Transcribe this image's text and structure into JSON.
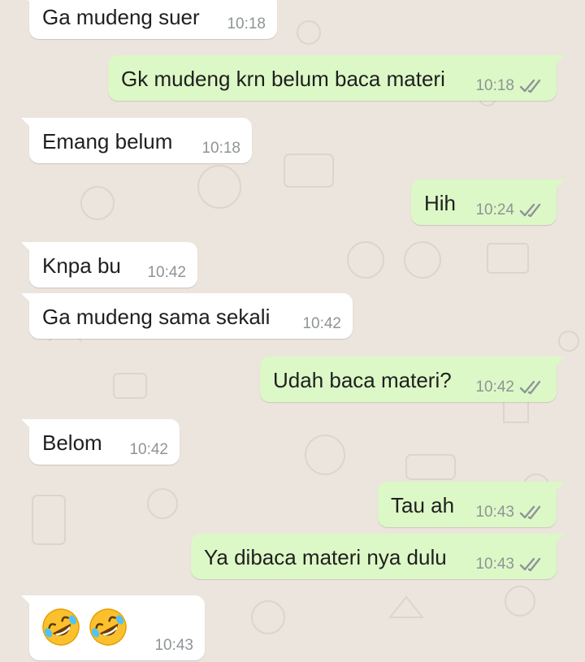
{
  "messages": [
    {
      "direction": "in",
      "text": "Ga mudeng suer",
      "time": "10:18"
    },
    {
      "direction": "out",
      "text": "Gk mudeng krn belum baca materi",
      "time": "10:18",
      "status": "double-check-icon"
    },
    {
      "direction": "in",
      "text": "Emang belum",
      "time": "10:18"
    },
    {
      "direction": "out",
      "text": "Hih",
      "time": "10:24",
      "status": "double-check-icon"
    },
    {
      "direction": "in",
      "text": "Knpa bu",
      "time": "10:42"
    },
    {
      "direction": "in",
      "text": "Ga mudeng sama sekali",
      "time": "10:42"
    },
    {
      "direction": "out",
      "text": "Udah baca materi?",
      "time": "10:42",
      "status": "double-check-icon"
    },
    {
      "direction": "in",
      "text": "Belom",
      "time": "10:42"
    },
    {
      "direction": "out",
      "text": "Tau ah",
      "time": "10:43",
      "status": "double-check-icon"
    },
    {
      "direction": "out",
      "text": "Ya dibaca materi nya dulu",
      "time": "10:43",
      "status": "double-check-icon"
    },
    {
      "direction": "in",
      "emoji": [
        "rolling-on-floor-laughing",
        "rolling-on-floor-laughing"
      ],
      "time": "10:43"
    }
  ],
  "colors": {
    "background": "#ece5dd",
    "incoming_bubble": "#ffffff",
    "outgoing_bubble": "#dcf8c6",
    "timestamp": "#8f9497",
    "ticks": "#8f9497"
  }
}
